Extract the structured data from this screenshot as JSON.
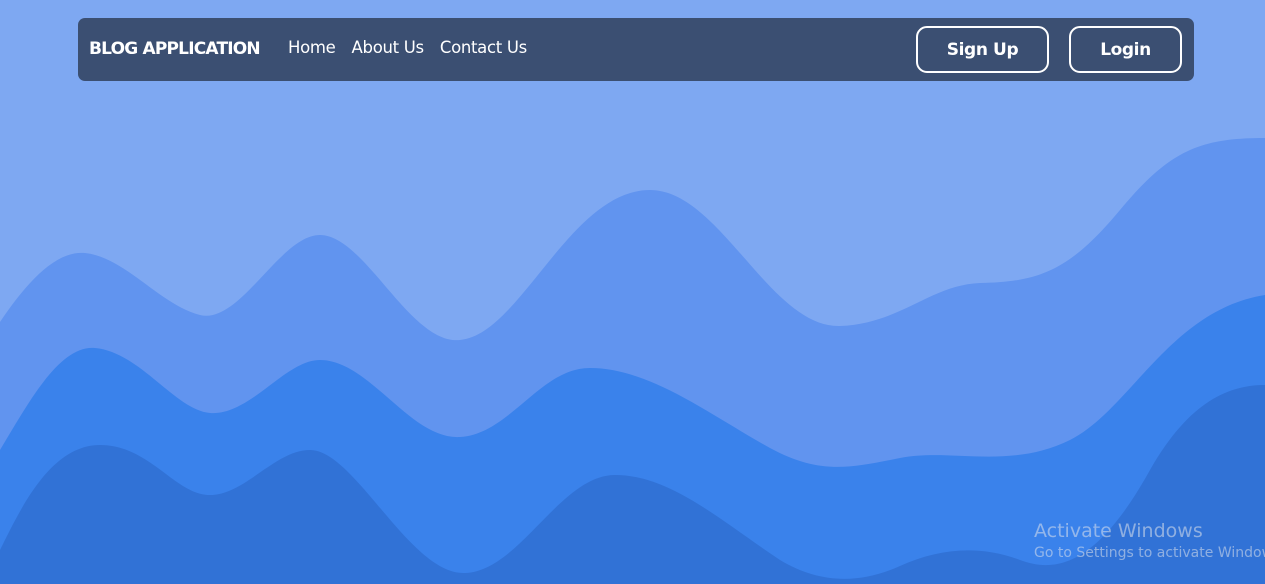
{
  "navbar": {
    "brand": "BLOG APPLICATION",
    "links": [
      {
        "label": "Home"
      },
      {
        "label": "About Us"
      },
      {
        "label": "Contact Us"
      }
    ],
    "signup_label": "Sign Up",
    "login_label": "Login"
  },
  "watermark": {
    "title": "Activate Windows",
    "subtitle": "Go to Settings to activate Windows."
  },
  "colors": {
    "background": "#7ea8f2",
    "navbar": "#3b4f72",
    "wave_light": "#6194ef",
    "wave_mid": "#3a82eb",
    "wave_dark": "#3172d6",
    "text": "#ffffff"
  }
}
